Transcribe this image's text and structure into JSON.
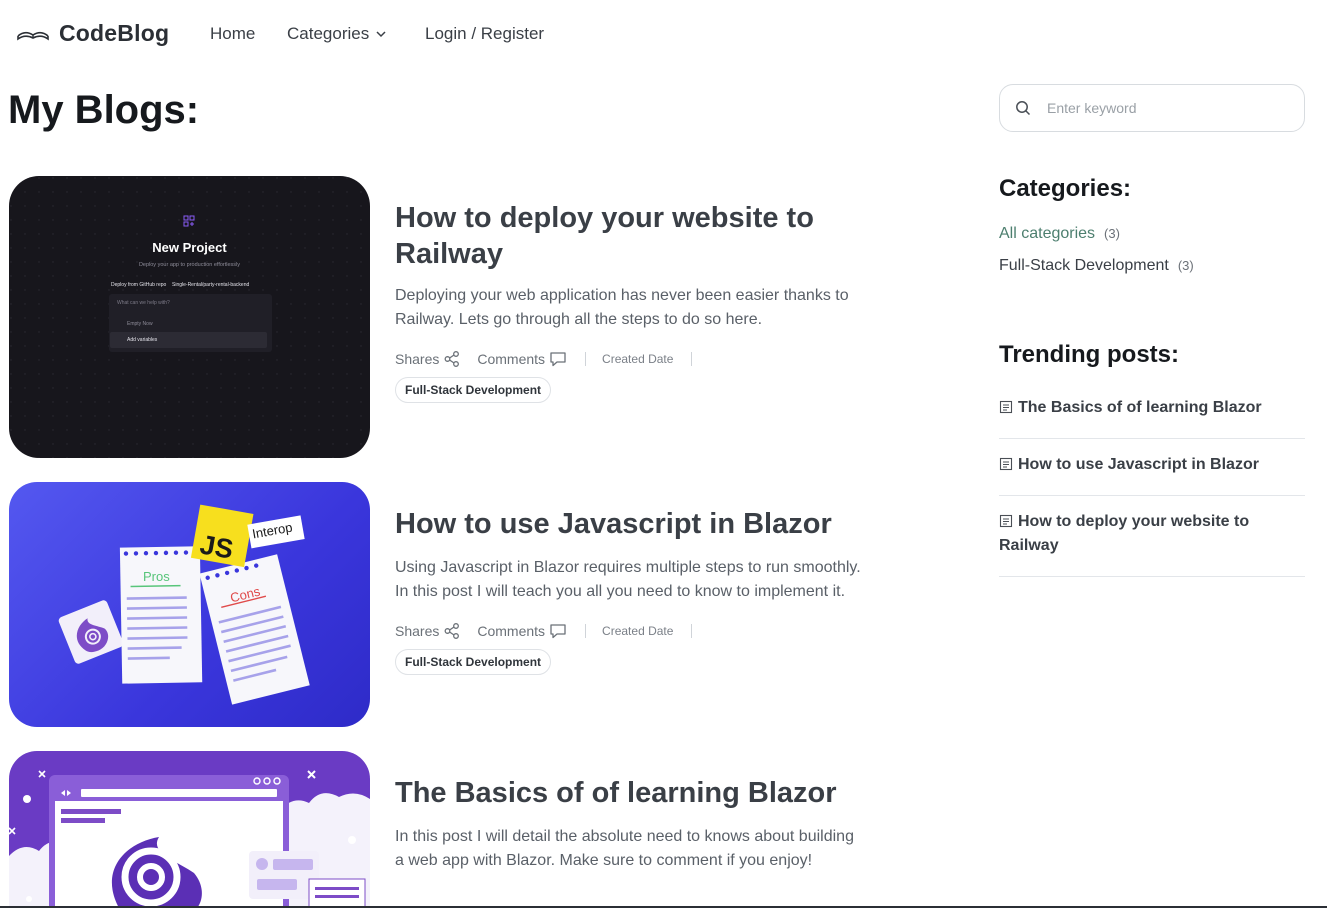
{
  "nav": {
    "brand": "CodeBlog",
    "home": "Home",
    "categories": "Categories",
    "login": "Login / Register"
  },
  "main": {
    "title": "My Blogs:",
    "posts": [
      {
        "title": "How to deploy your website to Railway",
        "excerpt": "Deploying your web application has never been easier thanks to Railway. Lets go through all the steps to do so here.",
        "shares": "Shares",
        "comments": "Comments",
        "created": "Created Date",
        "tag": "Full-Stack Development",
        "thumb": {
          "heading": "New Project",
          "sub": "Deploy your app to production effortlessly",
          "opt1": "Deploy from GitHub repo",
          "opt2": "Single-Rental/party-rental-backend",
          "ask": "What can we help with?",
          "item1": "Empty Now",
          "item2": "Add variables"
        }
      },
      {
        "title": "How to use Javascript in Blazor",
        "excerpt": "Using Javascript in Blazor requires multiple steps to run smoothly. In this post I will teach you all you need to know to implement it.",
        "shares": "Shares",
        "comments": "Comments",
        "created": "Created Date",
        "tag": "Full-Stack Development",
        "thumb": {
          "js": "JS",
          "interop": "Interop",
          "pros": "Pros",
          "cons": "Cons"
        }
      },
      {
        "title": "The Basics of of learning Blazor",
        "excerpt": "In this post I will detail the absolute need to knows about building a web app with Blazor. Make sure to comment if you enjoy!"
      }
    ]
  },
  "sidebar": {
    "search_placeholder": "Enter keyword",
    "categories_title": "Categories:",
    "categories": [
      {
        "label": "All categories",
        "count": "(3)"
      },
      {
        "label": "Full-Stack Development",
        "count": "(3)"
      }
    ],
    "trending_title": "Trending posts:",
    "trending": [
      "The Basics of of learning Blazor",
      "How to use Javascript in Blazor",
      "How to deploy your website to Railway"
    ]
  },
  "colors": {
    "accent_green": "#4d7f6f",
    "blazor_purple": "#512bd4",
    "js_yellow": "#f7df1e"
  }
}
